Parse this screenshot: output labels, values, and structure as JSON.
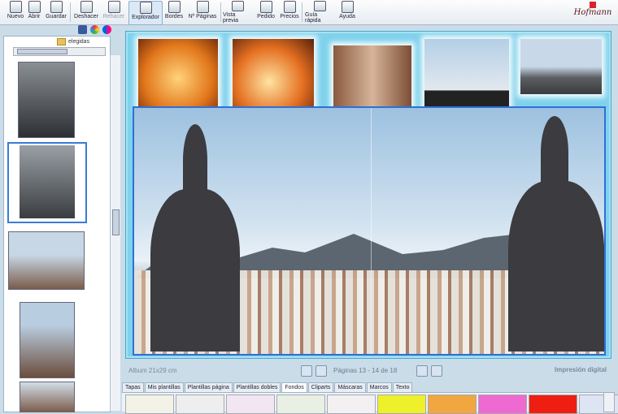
{
  "toolbar": {
    "buttons": [
      {
        "label": "Nuevo"
      },
      {
        "label": "Abrir"
      },
      {
        "label": "Guardar"
      },
      {
        "label": "Deshacer"
      },
      {
        "label": "Rehacer"
      },
      {
        "label": "Explorador"
      },
      {
        "label": "Bordes"
      },
      {
        "label": "Nº Páginas"
      },
      {
        "label": "Vista previa"
      },
      {
        "label": "Pedido"
      },
      {
        "label": "Precios"
      },
      {
        "label": "Guía rápida"
      },
      {
        "label": "Ayuda"
      }
    ],
    "brand": "Hofmann"
  },
  "explorer": {
    "folder": "elegidas"
  },
  "footer": {
    "album_size": "Album 21x29 cm",
    "pages_label": "Páginas 13 - 14 de 18",
    "print_type": "Impresión digital"
  },
  "tabs": [
    {
      "label": "Tapas"
    },
    {
      "label": "Mis plantillas"
    },
    {
      "label": "Plantillas página"
    },
    {
      "label": "Plantillas dobles"
    },
    {
      "label": "Fondos"
    },
    {
      "label": "Cliparts"
    },
    {
      "label": "Máscaras"
    },
    {
      "label": "Marcos"
    },
    {
      "label": "Texto"
    }
  ],
  "swatch_colors": [
    "#f2f2e6",
    "#eeeeee",
    "#f1e6f2",
    "#e9efe3",
    "#f3f0f2",
    "#eef02a",
    "#f2a640",
    "#ee6ad0",
    "#ee1f12",
    "#dde4f2"
  ],
  "colors": {
    "accent": "#2f6fd6",
    "canvas": "#7fd2ec"
  }
}
